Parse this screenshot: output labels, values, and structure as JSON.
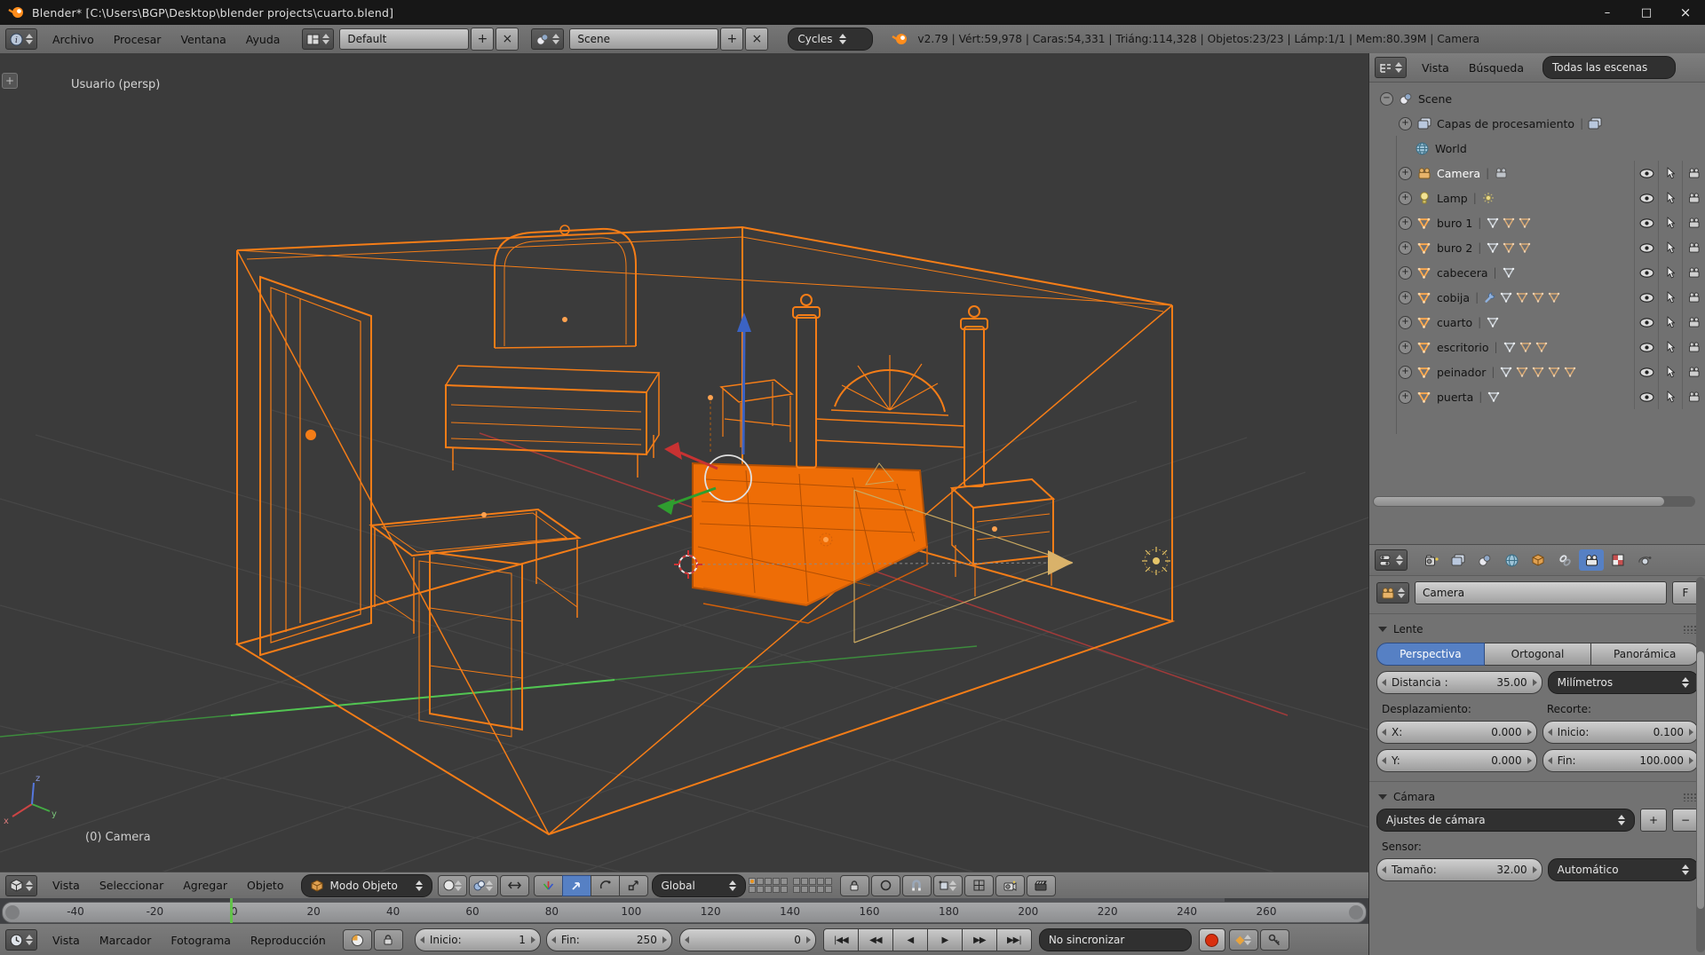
{
  "colors": {
    "accent_orange": "#f57d17",
    "accent_blue": "#5680c4",
    "playhead_green": "#62c24a",
    "selected_text": "#ffffff"
  },
  "title_bar": {
    "title": "Blender* [C:\\Users\\BGP\\Desktop\\blender projects\\cuarto.blend]"
  },
  "info_bar": {
    "menus": [
      "Archivo",
      "Procesar",
      "Ventana",
      "Ayuda"
    ],
    "layout_name": "Default",
    "scene_name": "Scene",
    "engine": "Cycles",
    "stats": "v2.79 | Vért:59,978 | Caras:54,331 | Triáng:114,328 | Objetos:23/23 | Lámp:1/1 | Mem:80.39M | Camera"
  },
  "viewport": {
    "view_label": "Usuario (persp)",
    "active_object_label": "(0) Camera",
    "header": {
      "menus": [
        "Vista",
        "Seleccionar",
        "Agregar",
        "Objeto"
      ],
      "mode": "Modo Objeto",
      "orientation": "Global",
      "icons": [
        "draw-mode",
        "shading",
        "pivot-point",
        "manip-axis",
        "manip-translate",
        "manip-rotate",
        "manip-scale",
        "lock",
        "proportional-edit",
        "snap-magnet",
        "snap-element",
        "render-border",
        "render-opengl-still",
        "render-opengl-anim"
      ]
    }
  },
  "outliner": {
    "menus": [
      "Vista",
      "Búsqueda"
    ],
    "display_filter": "Todas las escenas",
    "root": "Scene",
    "items": [
      {
        "label": "Capas de procesamiento",
        "icon": "renderlayers",
        "expand": true,
        "sub_icons": [
          "renderlayers"
        ],
        "toggles": false
      },
      {
        "label": "World",
        "icon": "world",
        "expand": false,
        "toggles": false
      },
      {
        "label": "Camera",
        "icon": "camera-obj",
        "expand": true,
        "selected": true,
        "sub_icons": [
          "camera-data"
        ],
        "toggles": true
      },
      {
        "label": "Lamp",
        "icon": "lamp-obj",
        "expand": true,
        "sub_icons": [
          "sun"
        ],
        "toggles": true
      },
      {
        "label": "buro 1",
        "icon": "mesh-orange",
        "expand": true,
        "sub_icons": [
          "mesh-gray",
          "mesh-tan",
          "mesh-tan"
        ],
        "toggles": true
      },
      {
        "label": "buro 2",
        "icon": "mesh-orange",
        "expand": true,
        "sub_icons": [
          "mesh-gray",
          "mesh-tan",
          "mesh-tan"
        ],
        "toggles": true
      },
      {
        "label": "cabecera",
        "icon": "mesh-orange",
        "expand": true,
        "sub_icons": [
          "mesh-gray"
        ],
        "toggles": true
      },
      {
        "label": "cobija",
        "icon": "mesh-orange",
        "expand": true,
        "sub_icons": [
          "wrench",
          "mesh-gray",
          "mesh-tan",
          "mesh-tan",
          "mesh-tan"
        ],
        "toggles": true
      },
      {
        "label": "cuarto",
        "icon": "mesh-orange",
        "expand": true,
        "sub_icons": [
          "mesh-gray"
        ],
        "toggles": true
      },
      {
        "label": "escritorio",
        "icon": "mesh-orange",
        "expand": true,
        "sub_icons": [
          "mesh-gray",
          "mesh-tan",
          "mesh-tan"
        ],
        "toggles": true
      },
      {
        "label": "peinador",
        "icon": "mesh-orange",
        "expand": true,
        "sub_icons": [
          "mesh-gray",
          "mesh-tan",
          "mesh-tan",
          "mesh-tan",
          "mesh-tan"
        ],
        "toggles": true
      },
      {
        "label": "puerta",
        "icon": "mesh-orange",
        "expand": true,
        "sub_icons": [
          "mesh-gray"
        ],
        "toggles": true
      }
    ]
  },
  "properties": {
    "tabs": [
      "render",
      "render-layers",
      "scene",
      "world",
      "object",
      "constraints",
      "camera-data",
      "texture",
      "physics"
    ],
    "active_tab": "camera-data",
    "datablock": {
      "value": "Camera",
      "fake_user": "F"
    },
    "lens_panel": {
      "title": "Lente",
      "type_tabs": [
        "Perspectiva",
        "Ortogonal",
        "Panorámica"
      ],
      "active_type": "Perspectiva",
      "focal_label": "Distancia :",
      "focal_value": "35.00",
      "unit": "Milímetros",
      "shift_label": "Desplazamiento:",
      "shift_x_label": "X:",
      "shift_x_value": "0.000",
      "shift_y_label": "Y:",
      "shift_y_value": "0.000",
      "clip_label": "Recorte:",
      "clip_start_label": "Inicio:",
      "clip_start_value": "0.100",
      "clip_end_label": "Fin:",
      "clip_end_value": "100.000"
    },
    "camera_panel": {
      "title": "Cámara",
      "preset": "Ajustes de cámara",
      "sensor_label": "Sensor:",
      "sensor_size_label": "Tamaño:",
      "sensor_size_value": "32.00",
      "sensor_fit": "Automático"
    }
  },
  "timeline": {
    "ticks": [
      "-40",
      "-20",
      "0",
      "20",
      "40",
      "60",
      "80",
      "100",
      "120",
      "140",
      "160",
      "180",
      "200",
      "220",
      "240",
      "260"
    ],
    "menus": [
      "Vista",
      "Marcador",
      "Fotograma",
      "Reproducción"
    ],
    "start_label": "Inicio:",
    "start_value": "1",
    "end_label": "Fin:",
    "end_value": "250",
    "frame_value": "0",
    "playback": [
      "jump-start",
      "prev-keyframe",
      "play-reverse",
      "play",
      "next-keyframe",
      "jump-end"
    ],
    "sync": "No sincronizar"
  }
}
